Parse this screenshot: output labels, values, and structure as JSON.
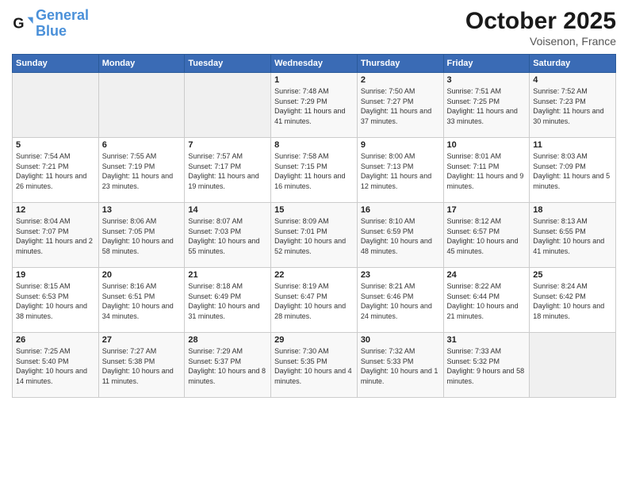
{
  "logo": {
    "line1": "General",
    "line2": "Blue"
  },
  "title": "October 2025",
  "location": "Voisenon, France",
  "headers": [
    "Sunday",
    "Monday",
    "Tuesday",
    "Wednesday",
    "Thursday",
    "Friday",
    "Saturday"
  ],
  "weeks": [
    [
      {
        "day": "",
        "sunrise": "",
        "sunset": "",
        "daylight": "",
        "empty": true
      },
      {
        "day": "",
        "sunrise": "",
        "sunset": "",
        "daylight": "",
        "empty": true
      },
      {
        "day": "",
        "sunrise": "",
        "sunset": "",
        "daylight": "",
        "empty": true
      },
      {
        "day": "1",
        "sunrise": "Sunrise: 7:48 AM",
        "sunset": "Sunset: 7:29 PM",
        "daylight": "Daylight: 11 hours and 41 minutes."
      },
      {
        "day": "2",
        "sunrise": "Sunrise: 7:50 AM",
        "sunset": "Sunset: 7:27 PM",
        "daylight": "Daylight: 11 hours and 37 minutes."
      },
      {
        "day": "3",
        "sunrise": "Sunrise: 7:51 AM",
        "sunset": "Sunset: 7:25 PM",
        "daylight": "Daylight: 11 hours and 33 minutes."
      },
      {
        "day": "4",
        "sunrise": "Sunrise: 7:52 AM",
        "sunset": "Sunset: 7:23 PM",
        "daylight": "Daylight: 11 hours and 30 minutes."
      }
    ],
    [
      {
        "day": "5",
        "sunrise": "Sunrise: 7:54 AM",
        "sunset": "Sunset: 7:21 PM",
        "daylight": "Daylight: 11 hours and 26 minutes."
      },
      {
        "day": "6",
        "sunrise": "Sunrise: 7:55 AM",
        "sunset": "Sunset: 7:19 PM",
        "daylight": "Daylight: 11 hours and 23 minutes."
      },
      {
        "day": "7",
        "sunrise": "Sunrise: 7:57 AM",
        "sunset": "Sunset: 7:17 PM",
        "daylight": "Daylight: 11 hours and 19 minutes."
      },
      {
        "day": "8",
        "sunrise": "Sunrise: 7:58 AM",
        "sunset": "Sunset: 7:15 PM",
        "daylight": "Daylight: 11 hours and 16 minutes."
      },
      {
        "day": "9",
        "sunrise": "Sunrise: 8:00 AM",
        "sunset": "Sunset: 7:13 PM",
        "daylight": "Daylight: 11 hours and 12 minutes."
      },
      {
        "day": "10",
        "sunrise": "Sunrise: 8:01 AM",
        "sunset": "Sunset: 7:11 PM",
        "daylight": "Daylight: 11 hours and 9 minutes."
      },
      {
        "day": "11",
        "sunrise": "Sunrise: 8:03 AM",
        "sunset": "Sunset: 7:09 PM",
        "daylight": "Daylight: 11 hours and 5 minutes."
      }
    ],
    [
      {
        "day": "12",
        "sunrise": "Sunrise: 8:04 AM",
        "sunset": "Sunset: 7:07 PM",
        "daylight": "Daylight: 11 hours and 2 minutes."
      },
      {
        "day": "13",
        "sunrise": "Sunrise: 8:06 AM",
        "sunset": "Sunset: 7:05 PM",
        "daylight": "Daylight: 10 hours and 58 minutes."
      },
      {
        "day": "14",
        "sunrise": "Sunrise: 8:07 AM",
        "sunset": "Sunset: 7:03 PM",
        "daylight": "Daylight: 10 hours and 55 minutes."
      },
      {
        "day": "15",
        "sunrise": "Sunrise: 8:09 AM",
        "sunset": "Sunset: 7:01 PM",
        "daylight": "Daylight: 10 hours and 52 minutes."
      },
      {
        "day": "16",
        "sunrise": "Sunrise: 8:10 AM",
        "sunset": "Sunset: 6:59 PM",
        "daylight": "Daylight: 10 hours and 48 minutes."
      },
      {
        "day": "17",
        "sunrise": "Sunrise: 8:12 AM",
        "sunset": "Sunset: 6:57 PM",
        "daylight": "Daylight: 10 hours and 45 minutes."
      },
      {
        "day": "18",
        "sunrise": "Sunrise: 8:13 AM",
        "sunset": "Sunset: 6:55 PM",
        "daylight": "Daylight: 10 hours and 41 minutes."
      }
    ],
    [
      {
        "day": "19",
        "sunrise": "Sunrise: 8:15 AM",
        "sunset": "Sunset: 6:53 PM",
        "daylight": "Daylight: 10 hours and 38 minutes."
      },
      {
        "day": "20",
        "sunrise": "Sunrise: 8:16 AM",
        "sunset": "Sunset: 6:51 PM",
        "daylight": "Daylight: 10 hours and 34 minutes."
      },
      {
        "day": "21",
        "sunrise": "Sunrise: 8:18 AM",
        "sunset": "Sunset: 6:49 PM",
        "daylight": "Daylight: 10 hours and 31 minutes."
      },
      {
        "day": "22",
        "sunrise": "Sunrise: 8:19 AM",
        "sunset": "Sunset: 6:47 PM",
        "daylight": "Daylight: 10 hours and 28 minutes."
      },
      {
        "day": "23",
        "sunrise": "Sunrise: 8:21 AM",
        "sunset": "Sunset: 6:46 PM",
        "daylight": "Daylight: 10 hours and 24 minutes."
      },
      {
        "day": "24",
        "sunrise": "Sunrise: 8:22 AM",
        "sunset": "Sunset: 6:44 PM",
        "daylight": "Daylight: 10 hours and 21 minutes."
      },
      {
        "day": "25",
        "sunrise": "Sunrise: 8:24 AM",
        "sunset": "Sunset: 6:42 PM",
        "daylight": "Daylight: 10 hours and 18 minutes."
      }
    ],
    [
      {
        "day": "26",
        "sunrise": "Sunrise: 7:25 AM",
        "sunset": "Sunset: 5:40 PM",
        "daylight": "Daylight: 10 hours and 14 minutes."
      },
      {
        "day": "27",
        "sunrise": "Sunrise: 7:27 AM",
        "sunset": "Sunset: 5:38 PM",
        "daylight": "Daylight: 10 hours and 11 minutes."
      },
      {
        "day": "28",
        "sunrise": "Sunrise: 7:29 AM",
        "sunset": "Sunset: 5:37 PM",
        "daylight": "Daylight: 10 hours and 8 minutes."
      },
      {
        "day": "29",
        "sunrise": "Sunrise: 7:30 AM",
        "sunset": "Sunset: 5:35 PM",
        "daylight": "Daylight: 10 hours and 4 minutes."
      },
      {
        "day": "30",
        "sunrise": "Sunrise: 7:32 AM",
        "sunset": "Sunset: 5:33 PM",
        "daylight": "Daylight: 10 hours and 1 minute."
      },
      {
        "day": "31",
        "sunrise": "Sunrise: 7:33 AM",
        "sunset": "Sunset: 5:32 PM",
        "daylight": "Daylight: 9 hours and 58 minutes."
      },
      {
        "day": "",
        "sunrise": "",
        "sunset": "",
        "daylight": "",
        "empty": true
      }
    ]
  ]
}
